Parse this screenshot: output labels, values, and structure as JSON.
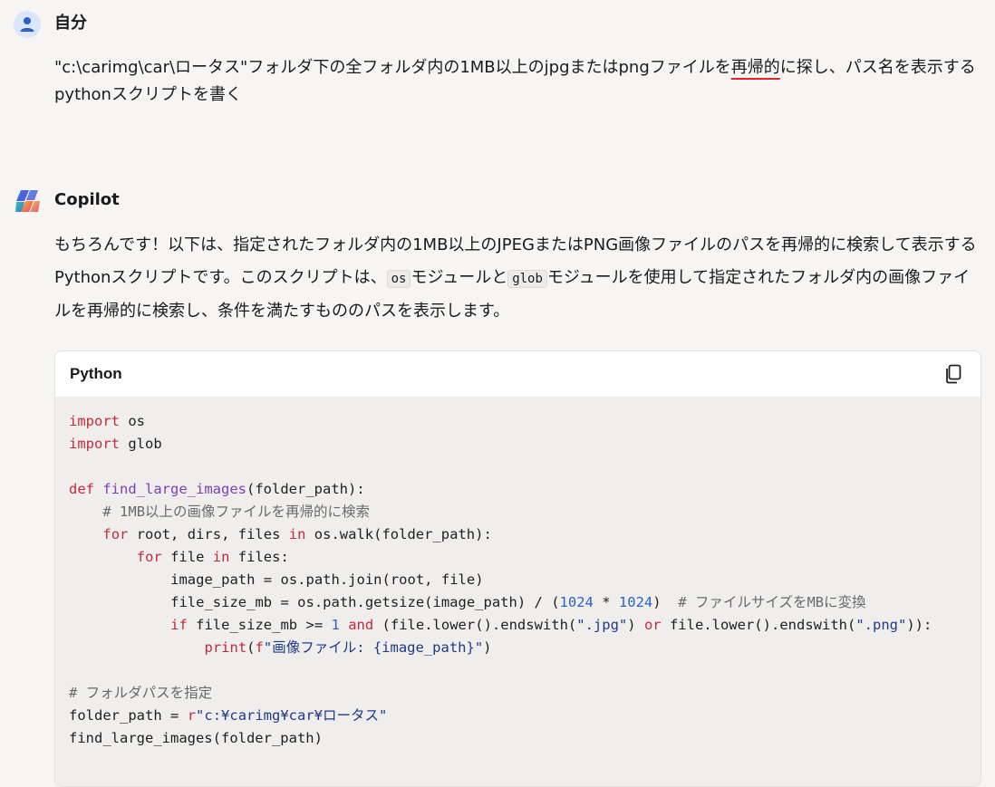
{
  "user": {
    "name": "自分",
    "message_before": "\"c:\\carimg\\car\\ロータス\"フォルダ下の全フォルダ内の1MB以上のjpgまたはpngファイルを",
    "message_underlined": "再帰的",
    "message_after": "に探し、パス名を表示するpythonスクリプトを書く"
  },
  "copilot": {
    "name": "Copilot",
    "reply_part1": "もちろんです！以下は、指定されたフォルダ内の1MB以上のJPEGまたはPNG画像ファイルのパスを再帰的に検索して表示するPythonスクリプトです。このスクリプトは、",
    "inline_code1": "os",
    "reply_part2": "モジュールと",
    "inline_code2": "glob",
    "reply_part3": "モジュールを使用して指定されたフォルダ内の画像ファイルを再帰的に検索し、条件を満たすもののパスを表示します。"
  },
  "code_block": {
    "language": "Python",
    "copy_icon": "copy-icon",
    "lines": [
      "import os",
      "import glob",
      "",
      "def find_large_images(folder_path):",
      "    # 1MB以上の画像ファイルを再帰的に検索",
      "    for root, dirs, files in os.walk(folder_path):",
      "        for file in files:",
      "            image_path = os.path.join(root, file)",
      "            file_size_mb = os.path.getsize(image_path) / (1024 * 1024)  # ファイルサイズをMBに変換",
      "            if file_size_mb >= 1 and (file.lower().endswith(\".jpg\") or file.lower().endswith(\".png\")):",
      "                print(f\"画像ファイル: {image_path}\")",
      "",
      "# フォルダパスを指定",
      "folder_path = r\"c:¥carimg¥car¥ロータス\"",
      "find_large_images(folder_path)"
    ]
  },
  "colors": {
    "keyword": "#c8283b",
    "function": "#7c3fb8",
    "number": "#2a63c7",
    "string": "#1f3a8a",
    "comment": "#6a6a6a",
    "underline": "#e0262b"
  }
}
